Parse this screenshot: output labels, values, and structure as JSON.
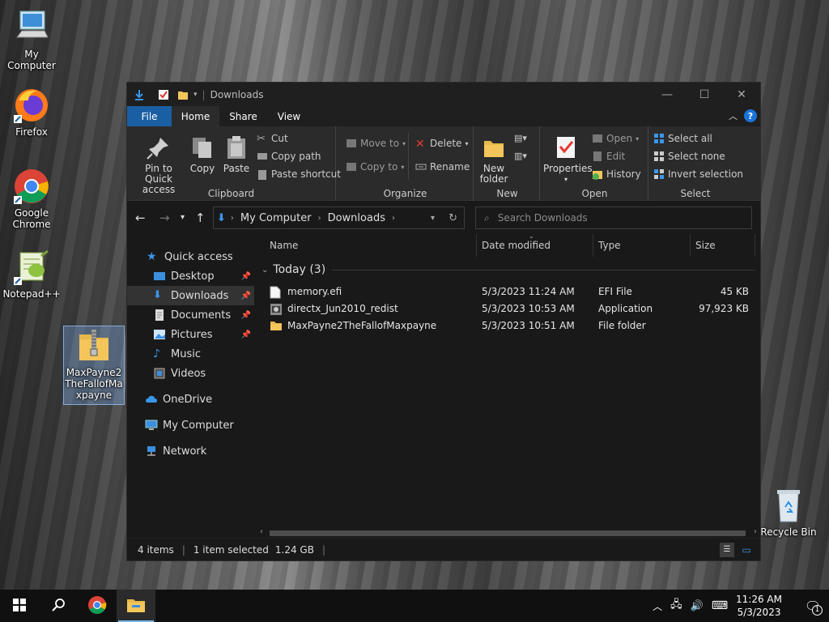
{
  "desktop": {
    "icons": [
      {
        "label": "My Computer",
        "icon": "computer-icon"
      },
      {
        "label": "Firefox",
        "icon": "firefox-icon"
      },
      {
        "label": "Google Chrome",
        "icon": "chrome-icon"
      },
      {
        "label": "Notepad++",
        "icon": "notepadpp-icon"
      },
      {
        "label": "MaxPayne2TheFallofMaxpayne",
        "icon": "zip-folder-icon"
      },
      {
        "label": "Recycle Bin",
        "icon": "recycle-bin-icon"
      }
    ]
  },
  "window": {
    "title": "Downloads",
    "caption": {
      "minimize": "—",
      "maximize": "☐",
      "close": "✕"
    },
    "tabs": [
      "File",
      "Home",
      "Share",
      "View"
    ],
    "ribbon": {
      "clipboard": {
        "label": "Clipboard",
        "pin": "Pin to Quick access",
        "copy": "Copy",
        "paste": "Paste",
        "cut": "Cut",
        "copy_path": "Copy path",
        "paste_shortcut": "Paste shortcut"
      },
      "organize": {
        "label": "Organize",
        "move_to": "Move to",
        "copy_to": "Copy to",
        "delete": "Delete",
        "rename": "Rename"
      },
      "new": {
        "label": "New",
        "new_folder": "New folder"
      },
      "open": {
        "label": "Open",
        "properties": "Properties",
        "open": "Open",
        "edit": "Edit",
        "history": "History"
      },
      "select": {
        "label": "Select",
        "select_all": "Select all",
        "select_none": "Select none",
        "invert": "Invert selection"
      }
    },
    "address": {
      "crumbs": [
        "My Computer",
        "Downloads"
      ],
      "search_placeholder": "Search Downloads"
    },
    "nav": {
      "quick_access": "Quick access",
      "items": [
        "Desktop",
        "Downloads",
        "Documents",
        "Pictures",
        "Music",
        "Videos"
      ],
      "onedrive": "OneDrive",
      "my_computer": "My Computer",
      "network": "Network"
    },
    "columns": [
      "Name",
      "Date modified",
      "Type",
      "Size"
    ],
    "group": "Today (3)",
    "files": [
      {
        "name": "memory.efi",
        "date": "5/3/2023 11:24 AM",
        "type": "EFI File",
        "size": "45 KB"
      },
      {
        "name": "directx_Jun2010_redist",
        "date": "5/3/2023 10:53 AM",
        "type": "Application",
        "size": "97,923 KB"
      },
      {
        "name": "MaxPayne2TheFallofMaxpayne",
        "date": "5/3/2023 10:51 AM",
        "type": "File folder",
        "size": ""
      }
    ],
    "status": {
      "count": "4 items",
      "selected": "1 item selected",
      "size": "1.24 GB"
    }
  },
  "taskbar": {
    "time": "11:26 AM",
    "date": "5/3/2023",
    "notification_count": "1"
  },
  "colors": {
    "accent": "#1a5fa3",
    "window_bg": "#191919",
    "ribbon_bg": "#2b2b2b",
    "folder": "#f3c55b"
  }
}
